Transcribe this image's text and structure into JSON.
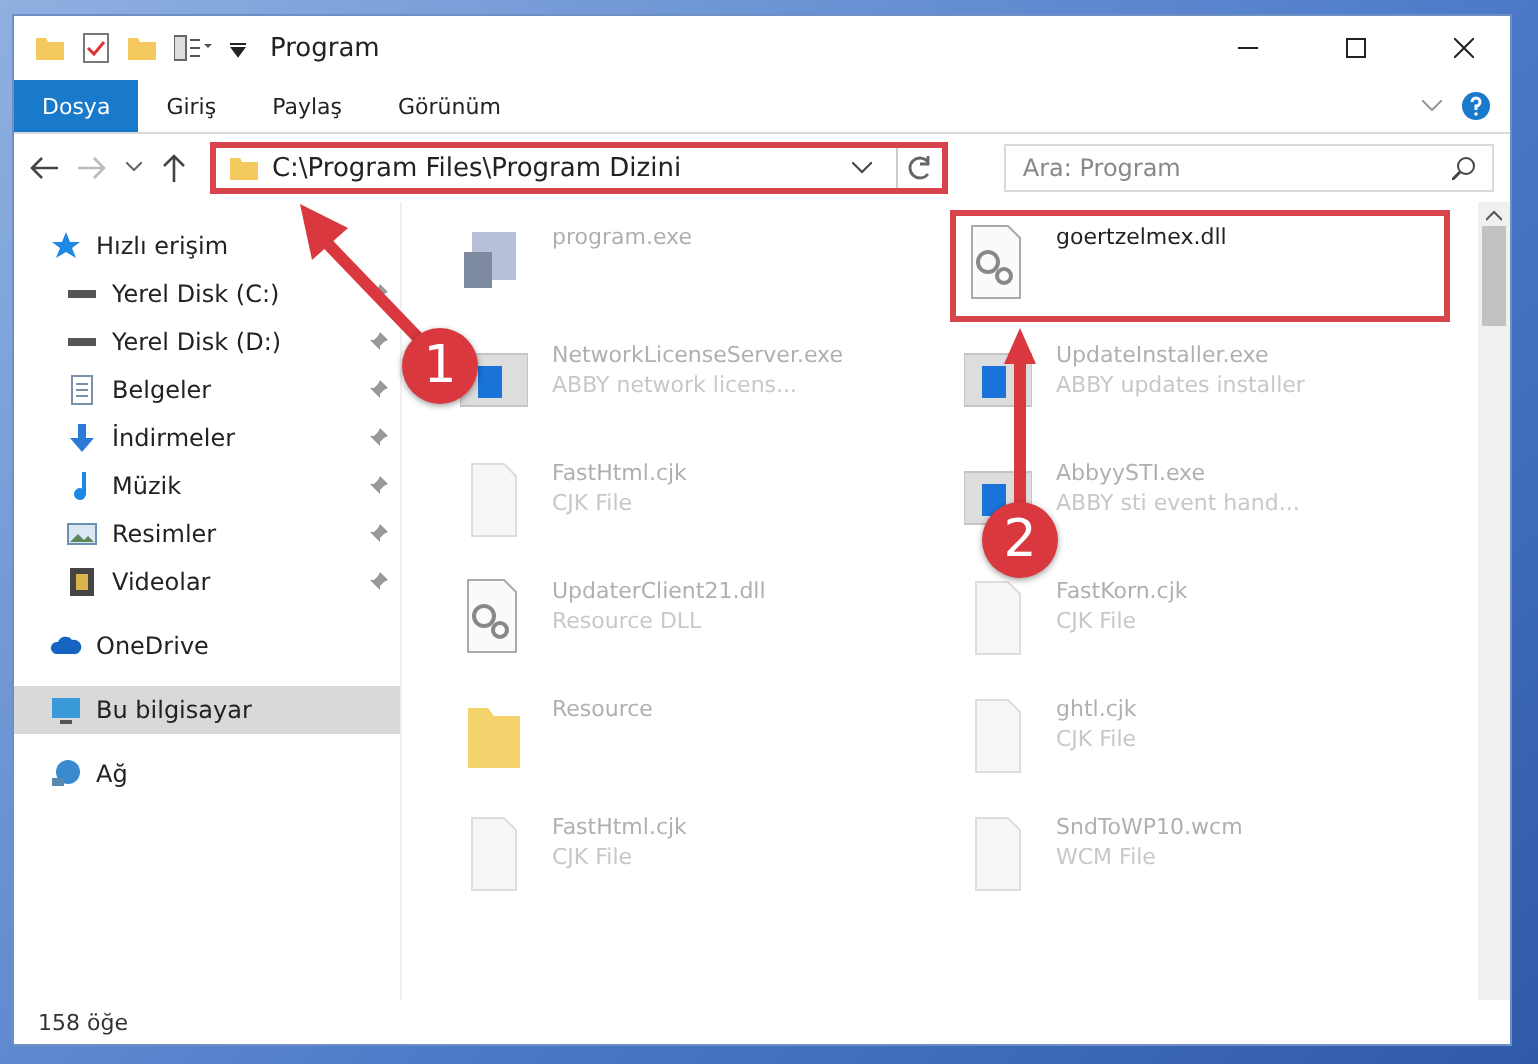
{
  "window": {
    "title": "Program"
  },
  "ribbon_tabs": [
    {
      "label": "Dosya",
      "selected": true
    },
    {
      "label": "Giriş",
      "selected": false
    },
    {
      "label": "Paylaş",
      "selected": false
    },
    {
      "label": "Görünüm",
      "selected": false
    }
  ],
  "address": {
    "path": "C:\\Program Files\\Program Dizini",
    "highlighted": true
  },
  "search": {
    "placeholder": "Ara: Program"
  },
  "sidebar": {
    "items": [
      {
        "label": "Hızlı erişim",
        "kind": "star",
        "pinned": false,
        "selected": false,
        "children": [
          {
            "label": "Yerel Disk (C:)",
            "kind": "drive",
            "pinned": true,
            "selected": false
          },
          {
            "label": "Yerel Disk (D:)",
            "kind": "drive",
            "pinned": true,
            "selected": false
          },
          {
            "label": "Belgeler",
            "kind": "doc",
            "pinned": true,
            "selected": false
          },
          {
            "label": "İndirmeler",
            "kind": "download",
            "pinned": true,
            "selected": false
          },
          {
            "label": "Müzik",
            "kind": "music",
            "pinned": true,
            "selected": false
          },
          {
            "label": "Resimler",
            "kind": "image",
            "pinned": true,
            "selected": false
          },
          {
            "label": "Videolar",
            "kind": "video",
            "pinned": true,
            "selected": false
          }
        ]
      },
      {
        "label": "OneDrive",
        "kind": "cloud",
        "pinned": false,
        "selected": false
      },
      {
        "label": "Bu bilgisayar",
        "kind": "pc",
        "pinned": false,
        "selected": true
      },
      {
        "label": "Ağ",
        "kind": "network",
        "pinned": false,
        "selected": false
      }
    ]
  },
  "files": [
    {
      "name": "program.exe",
      "kind": "setup",
      "highlighted": false
    },
    {
      "name": "goertzelmex.dll",
      "kind": "dll",
      "highlighted": true
    },
    {
      "name": "NetworkLicenseServer.exe",
      "type": "ABBY network licens...",
      "kind": "app",
      "highlighted": false
    },
    {
      "name": "UpdateInstaller.exe",
      "type": "ABBY updates installer",
      "kind": "app",
      "highlighted": false
    },
    {
      "name": "FastHtml.cjk",
      "type": "CJK File",
      "kind": "blank",
      "highlighted": false
    },
    {
      "name": "AbbyySTI.exe",
      "type": "ABBY sti event hand...",
      "kind": "app",
      "highlighted": false
    },
    {
      "name": "UpdaterClient21.dll",
      "type": "Resource DLL",
      "kind": "dll",
      "highlighted": false
    },
    {
      "name": "FastKorn.cjk",
      "type": "CJK File",
      "kind": "blank",
      "highlighted": false
    },
    {
      "name": "Resource",
      "kind": "folder",
      "highlighted": false
    },
    {
      "name": "ghtl.cjk",
      "type": "CJK File",
      "kind": "blank",
      "highlighted": false
    },
    {
      "name": "FastHtml.cjk",
      "type": "CJK File",
      "kind": "blank",
      "highlighted": false
    },
    {
      "name": "SndToWP10.wcm",
      "type": "WCM File",
      "kind": "blank",
      "highlighted": false
    }
  ],
  "status_bar": {
    "count": "158 öğe"
  },
  "annotations": [
    {
      "label": "1",
      "kind": "diagonal"
    },
    {
      "label": "2",
      "kind": "vertical"
    }
  ]
}
